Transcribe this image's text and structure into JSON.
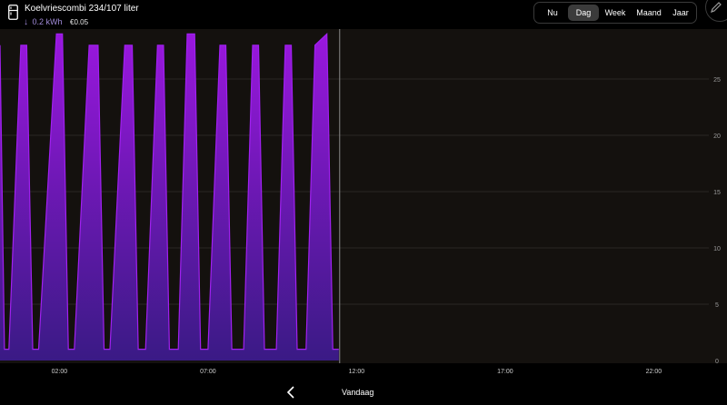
{
  "header": {
    "title": "Koelvriescombi 234/107 liter",
    "energy": "0.2 kWh",
    "cost": "€0.05",
    "device_icon": "fridge-icon",
    "arrow_icon": "arrow-down-icon",
    "edit_icon": "pencil-icon"
  },
  "period_tabs": [
    {
      "label": "Nu",
      "active": false
    },
    {
      "label": "Dag",
      "active": true
    },
    {
      "label": "Week",
      "active": false
    },
    {
      "label": "Maand",
      "active": false
    },
    {
      "label": "Jaar",
      "active": false
    }
  ],
  "footer": {
    "back_icon": "chevron-left-icon",
    "label": "Vandaag"
  },
  "colors": {
    "accent": "#a020f0",
    "fill_top": "#9a17de",
    "fill_bottom": "#3a1a85",
    "plot_bg": "#14110e",
    "grid": "#2a2724",
    "cursor": "#8a8a8a"
  },
  "chart_data": {
    "type": "area",
    "x_ticks": [
      "02:00",
      "07:00",
      "12:00",
      "17:00",
      "22:00"
    ],
    "y_ticks": [
      0,
      5,
      10,
      15,
      20,
      25
    ],
    "ylim": [
      0,
      29
    ],
    "xlim_hours": [
      0,
      24
    ],
    "current_time_hours": 11.4,
    "series": [
      {
        "x": [
          0,
          0.15,
          0.3,
          0.7,
          0.9,
          1.1,
          1.3,
          1.9,
          2.1,
          2.3,
          2.5,
          3.0,
          3.3,
          3.5,
          3.7,
          4.2,
          4.45,
          4.65,
          4.9,
          5.3,
          5.5,
          5.7,
          6.0,
          6.3,
          6.55,
          6.75,
          7.0,
          7.4,
          7.6,
          7.8,
          8.2,
          8.5,
          8.7,
          8.9,
          9.3,
          9.6,
          9.8,
          10.0,
          10.3,
          10.6,
          11.0,
          11.2,
          11.4
        ],
        "y": [
          28,
          1,
          1,
          28,
          28,
          1,
          1,
          29,
          29,
          1,
          1,
          28,
          28,
          1,
          1,
          28,
          28,
          1,
          1,
          28,
          28,
          1,
          1,
          29,
          29,
          1,
          1,
          28,
          28,
          1,
          1,
          28,
          28,
          1,
          1,
          28,
          28,
          1,
          1,
          28,
          29,
          1,
          1
        ]
      }
    ]
  }
}
